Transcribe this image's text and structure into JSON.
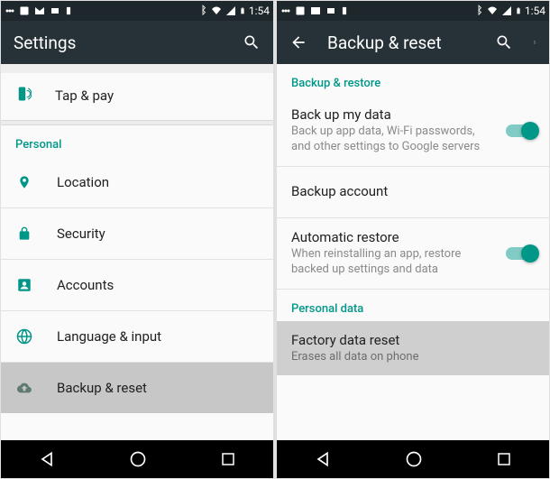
{
  "status": {
    "time": "1:54"
  },
  "left": {
    "title": "Settings",
    "top_item": "Tap & pay",
    "section": "Personal",
    "items": [
      {
        "label": "Location"
      },
      {
        "label": "Security"
      },
      {
        "label": "Accounts"
      },
      {
        "label": "Language & input"
      },
      {
        "label": "Backup & reset"
      }
    ]
  },
  "right": {
    "title": "Backup & reset",
    "section1": "Backup & restore",
    "backup_data": {
      "primary": "Back up my data",
      "secondary": "Back up app data, Wi-Fi passwords, and other settings to Google servers"
    },
    "backup_account": {
      "primary": "Backup account"
    },
    "auto_restore": {
      "primary": "Automatic restore",
      "secondary": "When reinstalling an app, restore backed up settings and data"
    },
    "section2": "Personal data",
    "factory": {
      "primary": "Factory data reset",
      "secondary": "Erases all data on phone"
    }
  }
}
